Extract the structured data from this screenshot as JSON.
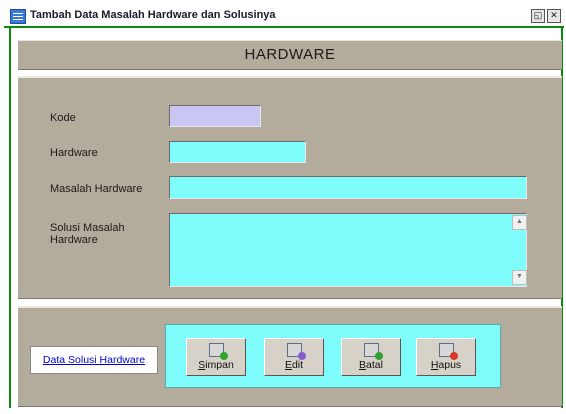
{
  "window": {
    "title": "Tambah Data Masalah Hardware dan Solusinya",
    "restore_glyph": "◱",
    "close_glyph": "✕"
  },
  "header": {
    "title": "HARDWARE"
  },
  "form": {
    "kode_label": "Kode",
    "kode_value": "",
    "hardware_label": "Hardware",
    "hardware_value": "",
    "masalah_label": "Masalah Hardware",
    "masalah_value": "",
    "solusi_label": "Solusi Masalah Hardware",
    "solusi_value": "",
    "scroll_up_glyph": "▲",
    "scroll_down_glyph": "▼"
  },
  "footer": {
    "link_label": "Data Solusi Hardware",
    "buttons": [
      {
        "hotkey": "S",
        "rest": "impan",
        "icon": "save-disk-icon"
      },
      {
        "hotkey": "E",
        "rest": "dit",
        "icon": "edit-pencil-icon"
      },
      {
        "hotkey": "B",
        "rest": "atal",
        "icon": "cancel-icon"
      },
      {
        "hotkey": "H",
        "rest": "apus",
        "icon": "delete-icon"
      }
    ]
  },
  "colors": {
    "panel": "#b3ac9d",
    "field": "#7ffcfc",
    "kode_field": "#c9c6f2",
    "frame": "#0a8a0a",
    "link": "#0000cc"
  }
}
